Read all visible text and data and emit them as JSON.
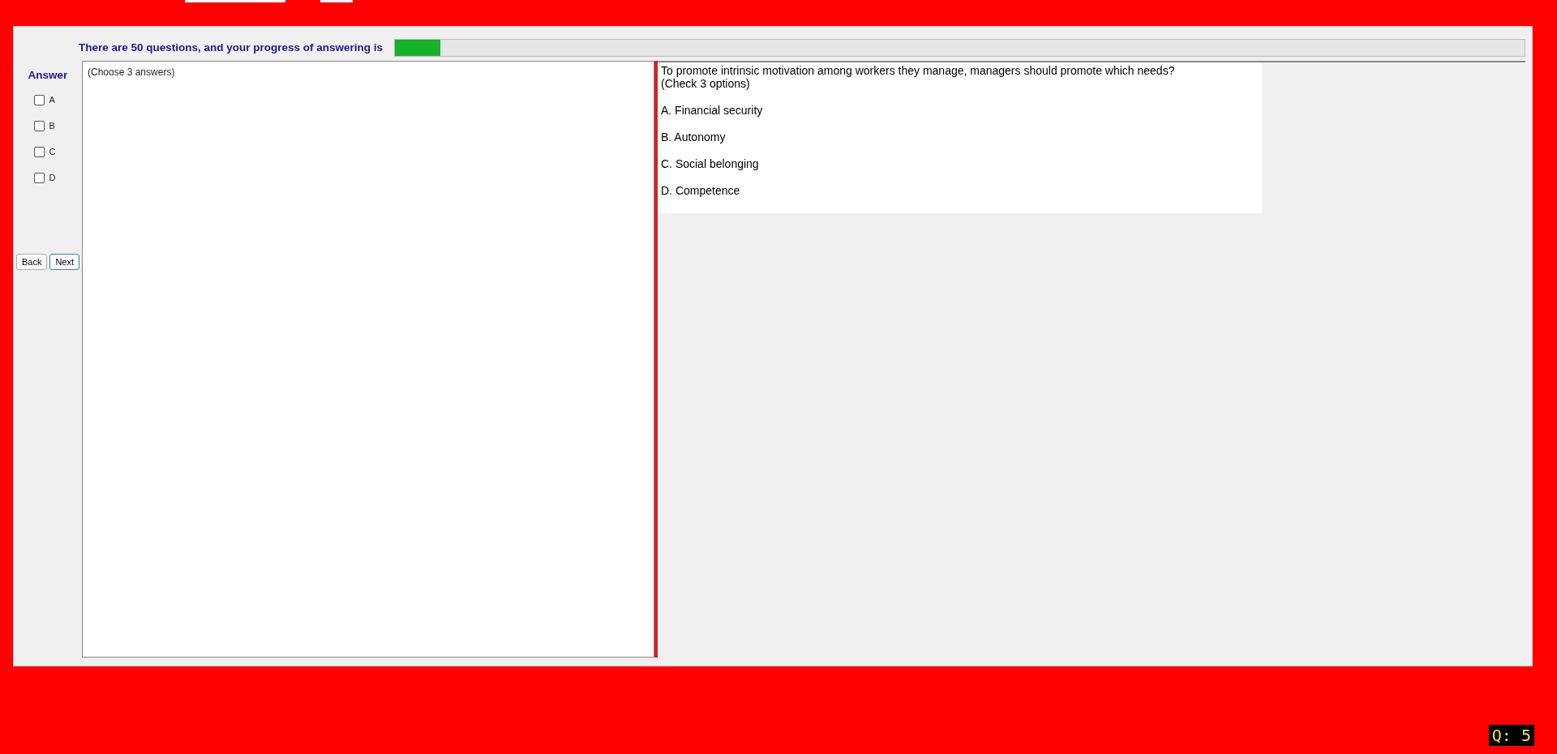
{
  "progress": {
    "text": "There are 50 questions, and your progress of answering is",
    "level": 0.04
  },
  "answer_panel": {
    "title": "Answer",
    "options": [
      {
        "label": "A",
        "checked": false
      },
      {
        "label": "B",
        "checked": false
      },
      {
        "label": "C",
        "checked": false
      },
      {
        "label": "D",
        "checked": false
      }
    ],
    "buttons": [
      "Back",
      "Next"
    ],
    "response_hint": "(Choose 3 answers)"
  },
  "question": {
    "lines": [
      "To promote intrinsic motivation among workers they manage, managers should promote which needs?",
      "(Check 3 options)"
    ],
    "choices": [
      "A.  Financial security",
      "B.  Autonomy",
      "C.  Social belonging",
      "D.  Competence"
    ]
  },
  "question_counter": "Q: 5"
}
